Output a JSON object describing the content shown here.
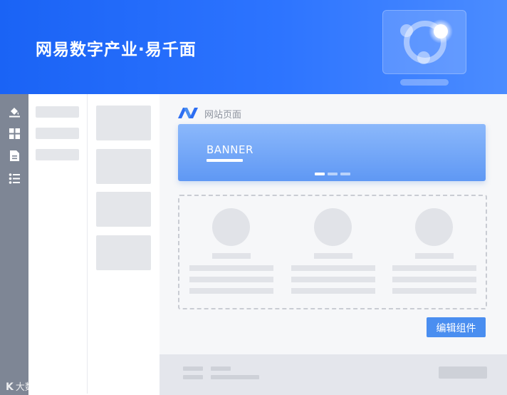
{
  "header": {
    "title": "网易数字产业·易千面"
  },
  "toolbar": {
    "tools": [
      "paint-bucket-icon",
      "grid-icon",
      "document-icon",
      "list-icon"
    ]
  },
  "site": {
    "title": "网站页面"
  },
  "banner": {
    "text": "BANNER",
    "slide_count": 3,
    "active_slide": 1
  },
  "actions": {
    "edit_label": "编辑组件"
  },
  "watermark": {
    "text": "大数跨境"
  },
  "colors": {
    "brand": "#1a63f5",
    "button": "#4a8ef0",
    "toolbar": "#7e8695"
  }
}
